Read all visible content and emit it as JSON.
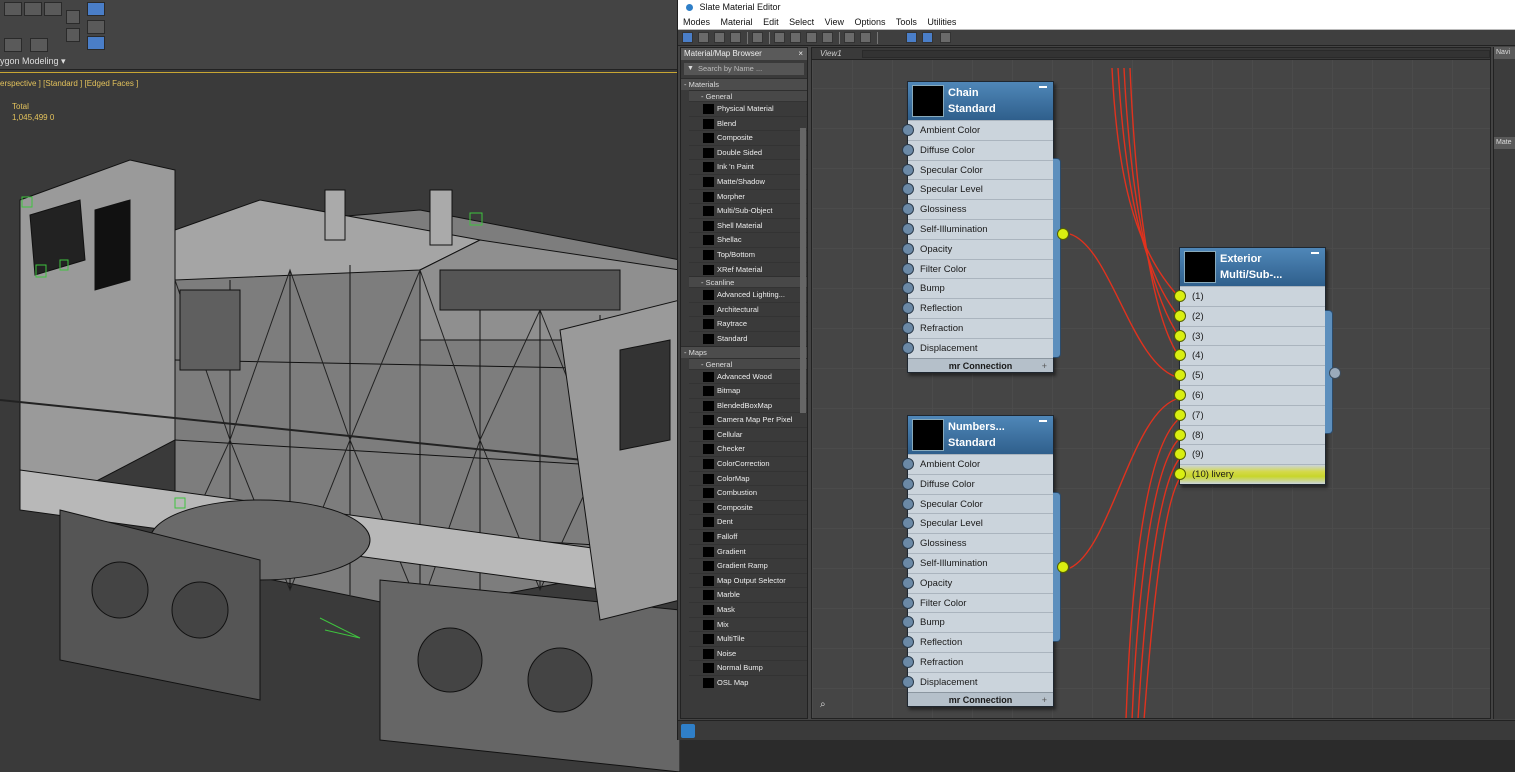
{
  "viewport": {
    "ribbon_label": "ygon Modeling ▾",
    "label": "erspective ] [Standard ] [Edged Faces ]",
    "stats_label": "Total",
    "stats_value": "1,045,499    0"
  },
  "editor": {
    "title": "Slate Material Editor",
    "menu": [
      "Modes",
      "Material",
      "Edit",
      "Select",
      "View",
      "Options",
      "Tools",
      "Utilities"
    ],
    "view_tab": "View1",
    "side_labels": [
      "Navi",
      "Mate"
    ]
  },
  "browser": {
    "title": "Material/Map Browser",
    "search_placeholder": "Search by Name ...",
    "materials_label": "- Materials",
    "general_label": "- General",
    "materials_general": [
      "Physical Material",
      "Blend",
      "Composite",
      "Double Sided",
      "Ink 'n Paint",
      "Matte/Shadow",
      "Morpher",
      "Multi/Sub-Object",
      "Shell Material",
      "Shellac",
      "Top/Bottom",
      "XRef Material"
    ],
    "scanline_label": "- Scanline",
    "materials_scanline": [
      "Advanced Lighting...",
      "Architectural",
      "Raytrace",
      "Standard"
    ],
    "maps_label": "- Maps",
    "maps_general_label": "- General",
    "maps_general": [
      "Advanced Wood",
      "Bitmap",
      "BlendedBoxMap",
      "Camera Map Per Pixel",
      "Cellular",
      "Checker",
      "ColorCorrection",
      "ColorMap",
      "Combustion",
      "Composite",
      "Dent",
      "Falloff",
      "Gradient",
      "Gradient Ramp",
      "Map Output Selector",
      "Marble",
      "Mask",
      "Mix",
      "MultiTile",
      "Noise",
      "Normal Bump",
      "OSL Map"
    ]
  },
  "nodes": {
    "chain": {
      "title_line1": "Chain",
      "title_line2": "Standard",
      "slots": [
        "Ambient Color",
        "Diffuse Color",
        "Specular Color",
        "Specular Level",
        "Glossiness",
        "Self-Illumination",
        "Opacity",
        "Filter Color",
        "Bump",
        "Reflection",
        "Refraction",
        "Displacement"
      ],
      "footer": "mr Connection"
    },
    "numbers": {
      "title_line1": "Numbers...",
      "title_line2": "Standard",
      "slots": [
        "Ambient Color",
        "Diffuse Color",
        "Specular Color",
        "Specular Level",
        "Glossiness",
        "Self-Illumination",
        "Opacity",
        "Filter Color",
        "Bump",
        "Reflection",
        "Refraction",
        "Displacement"
      ],
      "footer": "mr Connection"
    },
    "exterior": {
      "title_line1": "Exterior",
      "title_line2": "Multi/Sub-...",
      "slots": [
        "(1)",
        "(2)",
        "(3)",
        "(4)",
        "(5)",
        "(6)",
        "(7)",
        "(8)",
        "(9)",
        "(10) livery"
      ]
    }
  },
  "colors": {
    "wire": "#e0321e",
    "socket_active": "#d9ef11",
    "node_header": "#3f73a3",
    "highlight": "#c8d62a"
  }
}
